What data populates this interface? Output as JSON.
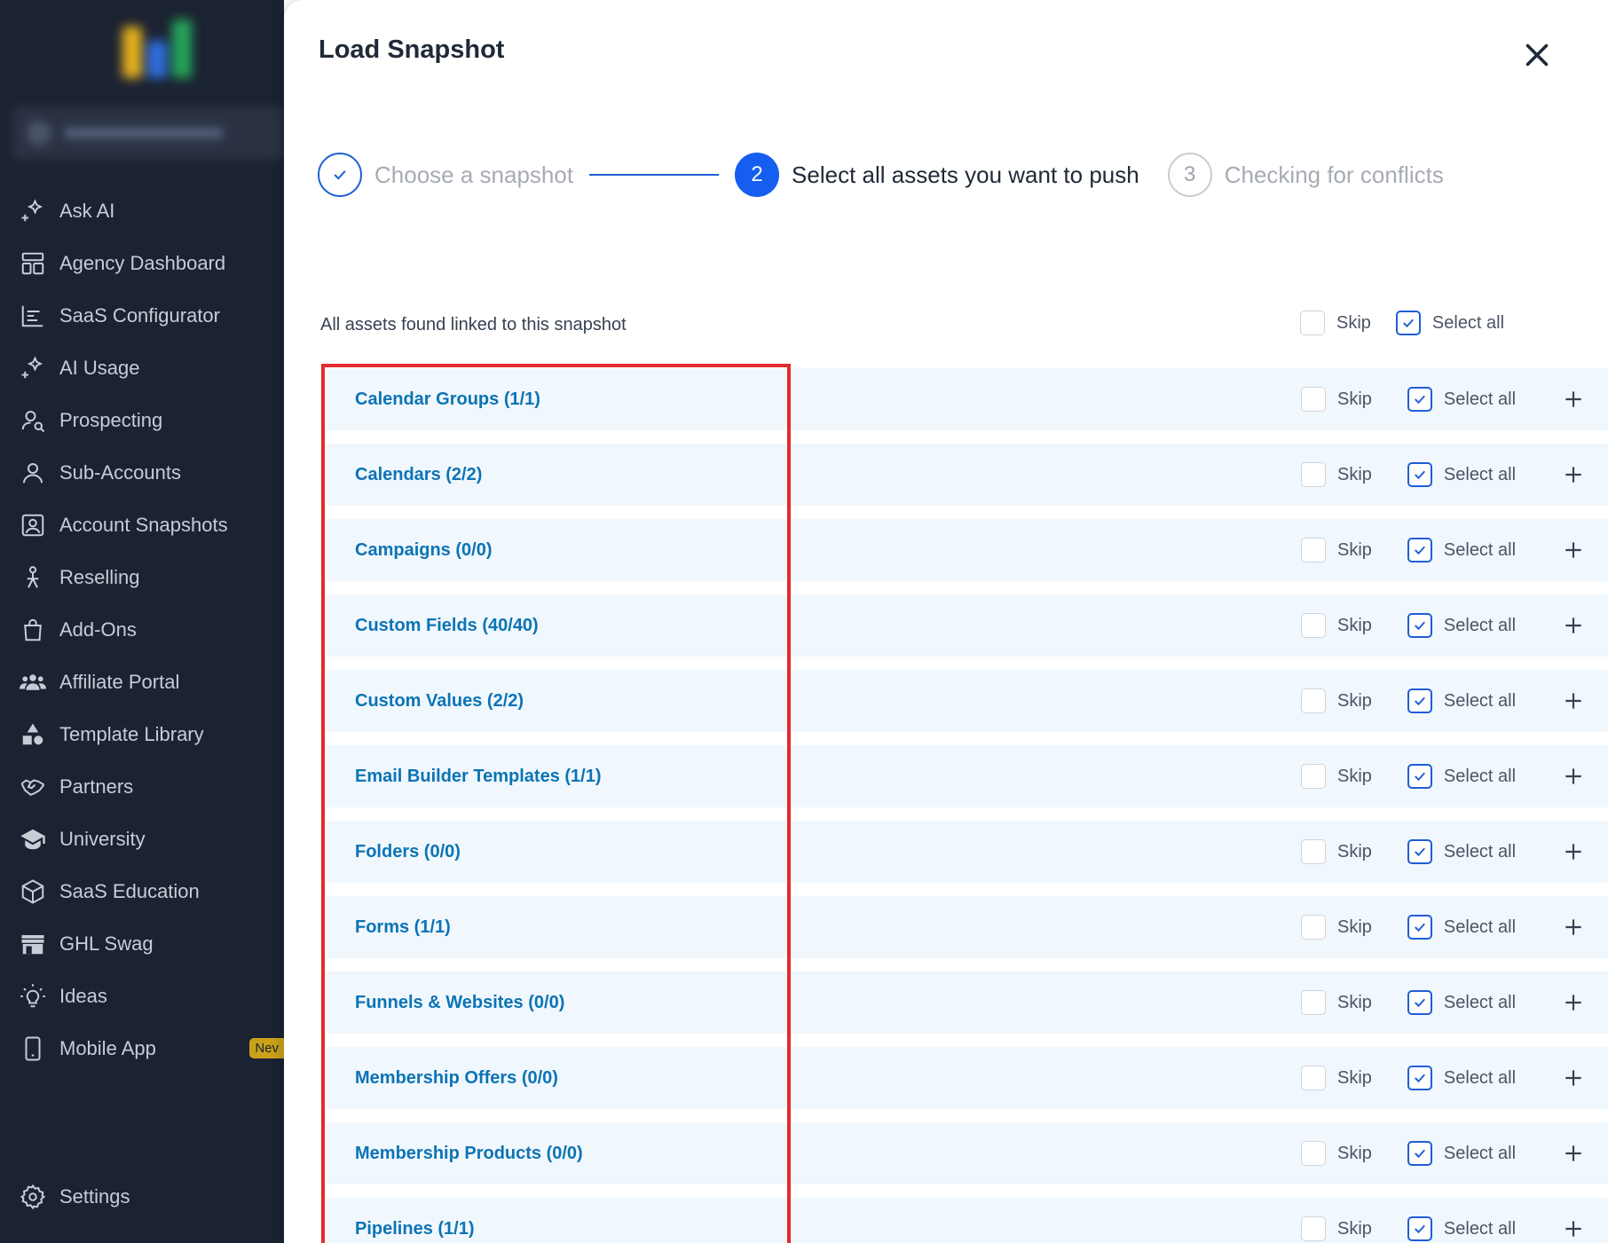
{
  "sidebar": {
    "items": [
      {
        "label": "Ask AI",
        "icon": "sparkle-icon"
      },
      {
        "label": "Agency Dashboard",
        "icon": "dashboard-icon"
      },
      {
        "label": "SaaS Configurator",
        "icon": "chart-icon"
      },
      {
        "label": "AI Usage",
        "icon": "sparkle-icon"
      },
      {
        "label": "Prospecting",
        "icon": "user-search-icon"
      },
      {
        "label": "Sub-Accounts",
        "icon": "user-icon"
      },
      {
        "label": "Account Snapshots",
        "icon": "snapshot-icon"
      },
      {
        "label": "Reselling",
        "icon": "reselling-icon"
      },
      {
        "label": "Add-Ons",
        "icon": "bag-icon"
      },
      {
        "label": "Affiliate Portal",
        "icon": "users-icon"
      },
      {
        "label": "Template Library",
        "icon": "shapes-icon"
      },
      {
        "label": "Partners",
        "icon": "handshake-icon"
      },
      {
        "label": "University",
        "icon": "graduation-icon"
      },
      {
        "label": "SaaS Education",
        "icon": "cube-icon"
      },
      {
        "label": "GHL Swag",
        "icon": "store-icon"
      },
      {
        "label": "Ideas",
        "icon": "lightbulb-icon"
      },
      {
        "label": "Mobile App",
        "icon": "phone-icon",
        "badge": "Nev"
      }
    ],
    "settings_label": "Settings"
  },
  "modal": {
    "title": "Load Snapshot",
    "steps": [
      {
        "label": "Choose a snapshot",
        "state": "done",
        "marker": "✓"
      },
      {
        "label": "Select all assets you want to push",
        "state": "active",
        "marker": "2"
      },
      {
        "label": "Checking for conflicts",
        "state": "todo",
        "marker": "3"
      }
    ],
    "assets_label": "All assets found linked to this snapshot",
    "skip_label": "Skip",
    "select_all_label": "Select all",
    "rows": [
      {
        "label": "Calendar Groups (1/1)"
      },
      {
        "label": "Calendars (2/2)"
      },
      {
        "label": "Campaigns (0/0)"
      },
      {
        "label": "Custom Fields (40/40)"
      },
      {
        "label": "Custom Values (2/2)"
      },
      {
        "label": "Email Builder Templates (1/1)"
      },
      {
        "label": "Folders (0/0)"
      },
      {
        "label": "Forms (1/1)"
      },
      {
        "label": "Funnels & Websites (0/0)"
      },
      {
        "label": "Membership Offers (0/0)"
      },
      {
        "label": "Membership Products (0/0)"
      },
      {
        "label": "Pipelines (1/1)"
      }
    ]
  },
  "colors": {
    "sidebar_bg": "#1b2232",
    "accent": "#155eef",
    "row_bg": "#f0f7fd",
    "row_text": "#0b74b5",
    "highlight": "#e32c2c"
  }
}
